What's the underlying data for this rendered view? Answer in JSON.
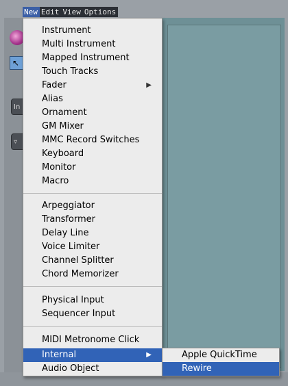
{
  "menubar": {
    "items": [
      {
        "label": "New",
        "active": true
      },
      {
        "label": "Edit",
        "active": false
      },
      {
        "label": "View",
        "active": false
      },
      {
        "label": "Options",
        "active": false
      }
    ]
  },
  "background": {
    "pill1_label": "In",
    "pill2_label": "▿"
  },
  "menu": {
    "groups": [
      [
        "Instrument",
        "Multi Instrument",
        "Mapped Instrument",
        "Touch Tracks",
        "Fader",
        "Alias",
        "Ornament",
        "GM Mixer",
        "MMC Record Switches",
        "Keyboard",
        "Monitor",
        "Macro"
      ],
      [
        "Arpeggiator",
        "Transformer",
        "Delay Line",
        "Voice Limiter",
        "Channel Splitter",
        "Chord Memorizer"
      ],
      [
        "Physical Input",
        "Sequencer Input"
      ],
      [
        "MIDI Metronome Click",
        "Internal",
        "Audio Object"
      ]
    ],
    "submenu_items": [
      "Fader",
      "Internal"
    ],
    "highlighted": "Internal"
  },
  "submenu": {
    "items": [
      "Apple QuickTime",
      "Rewire"
    ],
    "highlighted": "Rewire"
  },
  "colors": {
    "highlight": "#3163b7",
    "menu_bg": "#ececec"
  }
}
